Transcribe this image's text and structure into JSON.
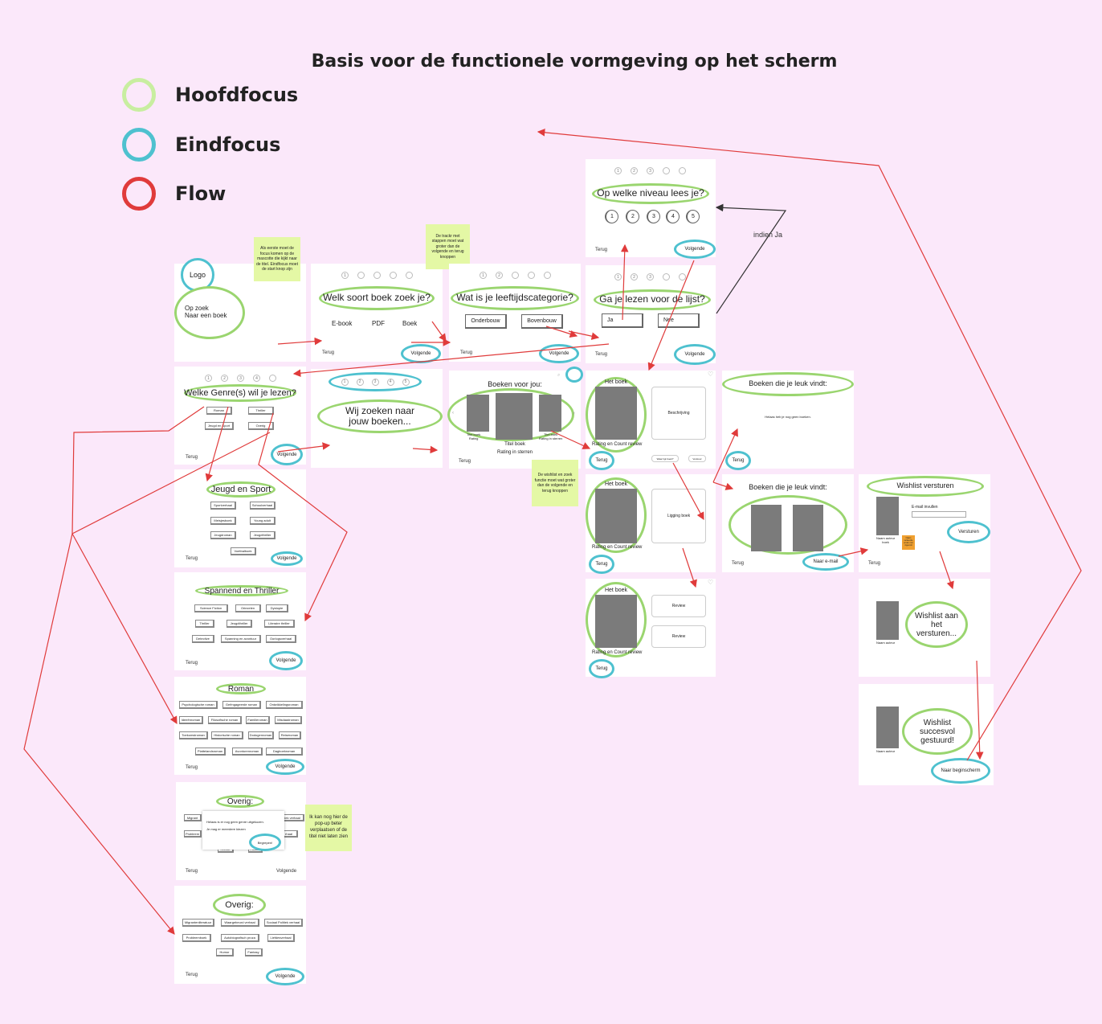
{
  "title": "Basis voor de functionele vormgeving op het scherm",
  "legend": [
    {
      "label": "Hoofdfocus",
      "color": "#b5e38a"
    },
    {
      "label": "Eindfocus",
      "color": "#4ec1cf"
    },
    {
      "label": "Flow",
      "color": "#e03b3b"
    }
  ],
  "nav": {
    "back": "Terug",
    "next": "Volgende"
  },
  "screens": {
    "start": {
      "logo": "Logo",
      "main": "Op zoek\nNaar een boek"
    },
    "type": {
      "q": "Welk soort boek zoek je?",
      "options": [
        "E-book",
        "PDF",
        "Boek"
      ]
    },
    "age": {
      "q": "Wat is je leeftijdscategorie?",
      "options": [
        "Onderbouw",
        "Bovenbouw"
      ]
    },
    "list": {
      "q": "Ga je lezen voor de lijst?",
      "options": [
        "Ja",
        "Nee"
      ]
    },
    "level": {
      "q": "Op welke niveau lees je?",
      "levels": [
        "1",
        "2",
        "3",
        "4",
        "5"
      ]
    },
    "genre": {
      "q": "Welke Genre(s) wil je lezen?",
      "options": [
        "Roman",
        "Thriller",
        "Jeugd en Sport",
        "Overig"
      ]
    },
    "jeugd": {
      "q": "Jeugd en Sport",
      "options": [
        "Sportverhaal",
        "Schoolverhaal",
        "Meisjesboek",
        "Young adult",
        "Jeugdroman",
        "Jeugdthriller",
        "Voetbalboek"
      ]
    },
    "spannend": {
      "q": "Spannend en Thriller",
      "options": [
        "Science Fiction",
        "Oriezelen",
        "Dystopie",
        "Thriller",
        "Jeugdthriller",
        "Literaire thriller",
        "Detective",
        "Spanning en avontuur",
        "Oorlogsverhaal"
      ]
    },
    "roman": {
      "q": "Roman",
      "options": [
        "Psychologische roman",
        "Geëngageerde roman",
        "Ontwikkelingsroman",
        "Ideeënroman",
        "Filosofische roman",
        "Familieroman",
        "Misdaadroman",
        "Toekomstroman",
        "Historische roman",
        "Dodogenroman",
        "Reiseroman",
        "Plattelandsroman",
        "Avonturenroman",
        "Dagboekroman"
      ]
    },
    "overig_popup": {
      "q": "Overig:",
      "popup": "Helaas is er nog geen genre uitgekozen.\nJe mag er meerdere kiezen",
      "popup_btn": "Begrepen!",
      "bg": [
        "Migrant",
        "Probleem",
        "Humor",
        "Familie",
        "tiek verhaal",
        "rhaal"
      ]
    },
    "overig": {
      "q": "Overig:",
      "options": [
        "Migrantenliteratuur",
        "Waargebeurd verhaal",
        "Sociaal Politiek verhaal",
        "Probleemboek",
        "Autobiografisch proza",
        "Liefdesverhaal",
        "Humor",
        "Fantasy"
      ]
    },
    "search": {
      "q": "Wij zoeken naar jouw boeken...",
      "dots": [
        "1",
        "2",
        "3",
        "4",
        "5"
      ]
    },
    "results": {
      "title": "Boeken voor jou:",
      "book_title": "Titel boek",
      "rating": "Rating in sterren",
      "small1": "Titel boek\nRating",
      "small2": "Titel boek\nRating in sterren"
    },
    "detail1": {
      "title": "Het boek",
      "rating": "Rating en Count review",
      "desc": "Beschrijving",
      "btn1": "Waar ligt boek?",
      "btn2": "Verstuur"
    },
    "detail2": {
      "title": "Het boek",
      "rating": "Rating en Count review",
      "loc": "Ligging boek"
    },
    "detail3": {
      "title": "Het boek",
      "rating": "Rating en Count review",
      "reviews": [
        "Review",
        "Review"
      ]
    },
    "wish_empty": {
      "title": "Boeken die je leuk vindt:",
      "msg": "Helaas heb je nog geen boeken."
    },
    "wish_full": {
      "title": "Boeken die je leuk vindt:",
      "btn": "Naar e-mail"
    },
    "send": {
      "title": "Wishlist versturen",
      "email": "E-mail invullen",
      "btn": "Versturen",
      "cover": "Naam auteur\nboek",
      "error": "Naam\nverkeerde\nemail, niet\ningevuld"
    },
    "sending": {
      "msg": "Wishlist aan het versturen...",
      "cover": "Naam auteur"
    },
    "done": {
      "msg": "Wishlist succesvol gestuurd!",
      "cover": "Naam auteur",
      "btn": "Naar beginscherm"
    }
  },
  "notes": {
    "mascotte": "Als eerste moet de focus komen op de mascotte die kijkt naar de titel. Eindfocus moet de start knop zijn",
    "tracker": "De trackr met stappen moet wat groter dan de volgende en terug knoppen",
    "wishlist": "De wishlist en zoek functie moet wat groter dan de volgende en terug knoppen",
    "popup": "Ik kan nog hier de pop-up beter verplaatsen of de titel niet laten zien"
  },
  "flow_label": "indien Ja",
  "dots5": [
    "1",
    "2",
    "3",
    "4",
    "5"
  ]
}
